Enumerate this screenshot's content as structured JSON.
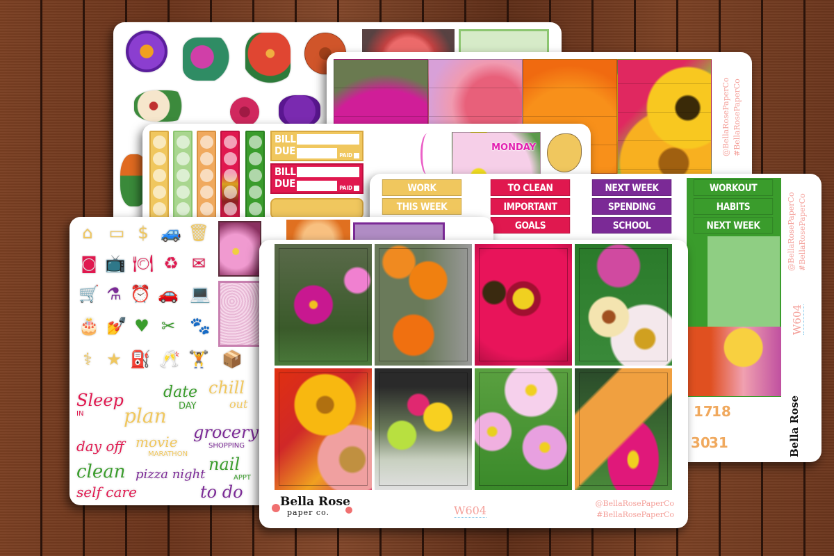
{
  "scene": {
    "description": "Bella Rose Paper Co planner sticker kit W604 laid out on a wooden table",
    "background": "dark-wood-planks"
  },
  "brand": {
    "name_line1": "Bella Rose",
    "name_line2": "paper co.",
    "kit_code": "W604",
    "handle": "@BellaRosePaperCo",
    "hashtag": "#BellaRosePaperCo"
  },
  "colors": {
    "yellow": "#f0c75e",
    "red": "#e0184f",
    "purple": "#7b2a96",
    "green": "#3a9c2c",
    "orange": "#f0a95e",
    "light_green": "#a9d68f",
    "pink_text": "#f4a09a",
    "monday_pink": "#e31fb0"
  },
  "floral_sheet": {
    "stickers": [
      "purple-zinnia",
      "magenta-violet-bouquet",
      "red-daisy-bouquet",
      "orange-dahlia",
      "cream-zinnia-pair",
      "red-rose",
      "purple-dahlia",
      "orange-marigold"
    ]
  },
  "photo_strip_sheet": {
    "tiles": [
      "magenta-cosmos",
      "pink-dahlias",
      "orange-zinnia",
      "sunflowers-and-zinnias"
    ]
  },
  "functional_sheet": {
    "checklists": [
      {
        "color": "yellow",
        "dots": 5
      },
      {
        "color": "light-green",
        "dots": 5
      },
      {
        "color": "orange",
        "dots": 5
      },
      {
        "color": "magenta-floral",
        "dots": 5
      },
      {
        "color": "green",
        "dots": 5
      }
    ],
    "bill_due": [
      {
        "line1": "BILL",
        "line2": "DUE",
        "paid": "PAID",
        "color": "yellow"
      },
      {
        "line1": "BILL",
        "line2": "DUE",
        "paid": "PAID",
        "color": "red"
      }
    ],
    "day_label": "MONDAY"
  },
  "header_sheet": {
    "columns": [
      {
        "color": "yellow",
        "items": [
          "WORK",
          "THIS WEEK"
        ]
      },
      {
        "color": "red",
        "items": [
          "TO CLEAN",
          "IMPORTANT",
          "GOALS"
        ]
      },
      {
        "color": "purple",
        "items": [
          "NEXT WEEK",
          "SPENDING",
          "SCHOOL"
        ]
      },
      {
        "color": "green",
        "items": [
          "WORKOUT",
          "HABITS",
          "NEXT WEEK"
        ]
      }
    ],
    "dates": [
      "17",
      "18",
      "30",
      "31"
    ],
    "side_handle": "@BellaRosePaperCo",
    "side_hashtag": "#BellaRosePaperCo",
    "side_code": "W604"
  },
  "icon_sheet": {
    "icon_rows": [
      {
        "color": "yellow",
        "icons": [
          "house",
          "credit-cards",
          "dollar",
          "jeep",
          "trash-can"
        ]
      },
      {
        "color": "red",
        "icons": [
          "washing-machine",
          "tv",
          "plate-fork-knife",
          "recycle",
          "envelope"
        ]
      },
      {
        "color": "purple",
        "icons": [
          "shopping-cart",
          "spray-bottle",
          "alarm-clock",
          "car",
          "laptop"
        ]
      },
      {
        "color": "green",
        "icons": [
          "birthday-cake",
          "nail-polish",
          "heart",
          "scissors-comb",
          "paw-print"
        ]
      },
      {
        "color": "yellow",
        "icons": [
          "stethoscope",
          "star",
          "gas-pump",
          "champagne-toast",
          "dumbbell-person",
          "box"
        ]
      }
    ],
    "scripts": [
      {
        "main": "Sleep",
        "sub": "IN",
        "color": "red"
      },
      {
        "main": "plan",
        "sub": "",
        "color": "yellow"
      },
      {
        "main": "date",
        "sub": "DAY",
        "color": "green"
      },
      {
        "main": "chill",
        "sub": "out",
        "color": "yellow"
      },
      {
        "main": "day off",
        "sub": "",
        "color": "red"
      },
      {
        "main": "movie",
        "sub": "MARATHON",
        "color": "yellow"
      },
      {
        "main": "grocery",
        "sub": "SHOPPING",
        "color": "purple"
      },
      {
        "main": "clean",
        "sub": "",
        "color": "green"
      },
      {
        "main": "pizza night",
        "sub": "",
        "color": "purple"
      },
      {
        "main": "nail",
        "sub": "APPT",
        "color": "green"
      },
      {
        "main": "self care",
        "sub": "",
        "color": "red"
      },
      {
        "main": "to do",
        "sub": "",
        "color": "purple"
      }
    ]
  },
  "front_sheet": {
    "tiles": [
      "magenta-cosmos-garden",
      "orange-zinnias",
      "bee-on-pink-zinnia",
      "pink-and-cream-zinnias",
      "yellow-and-red-flowers",
      "bouquet-in-jar",
      "pink-cosmos",
      "monarch-on-zinnia"
    ],
    "footer": {
      "logo_line1": "Bella Rose",
      "logo_line2": "paper co.",
      "code": "W604",
      "handle": "@BellaRosePaperCo",
      "hashtag": "#BellaRosePaperCo"
    }
  }
}
